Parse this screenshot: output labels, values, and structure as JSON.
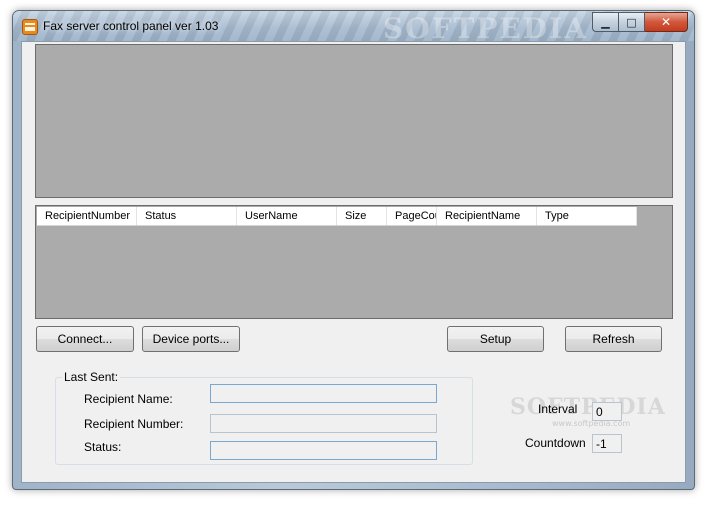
{
  "window": {
    "title": "Fax server control panel ver 1.03",
    "watermark": "SOFTPEDIA"
  },
  "caption_buttons": {
    "minimize": "▁",
    "maximize": "□",
    "close": "✕"
  },
  "list": {
    "columns": [
      "RecipientNumber",
      "Status",
      "UserName",
      "Size",
      "PageCou",
      "RecipientName",
      "Type"
    ]
  },
  "buttons": {
    "connect": "Connect...",
    "device_ports": "Device ports...",
    "setup": "Setup",
    "refresh": "Refresh"
  },
  "last_sent": {
    "legend": "Last Sent:",
    "recipient_name_label": "Recipient Name:",
    "recipient_number_label": "Recipient Number:",
    "status_label": "Status:",
    "recipient_name_value": "",
    "recipient_number_value": "",
    "status_value": ""
  },
  "timer": {
    "interval_label": "Interval",
    "interval_value": "0",
    "countdown_label": "Countdown",
    "countdown_value": "-1"
  },
  "watermark": {
    "brand": "SOFTPEDIA",
    "url": "www.softpedia.com"
  },
  "colors": {
    "panel_gray": "#ababab",
    "client_bg": "#f0f0f0",
    "close_red": "#c43b1d"
  }
}
